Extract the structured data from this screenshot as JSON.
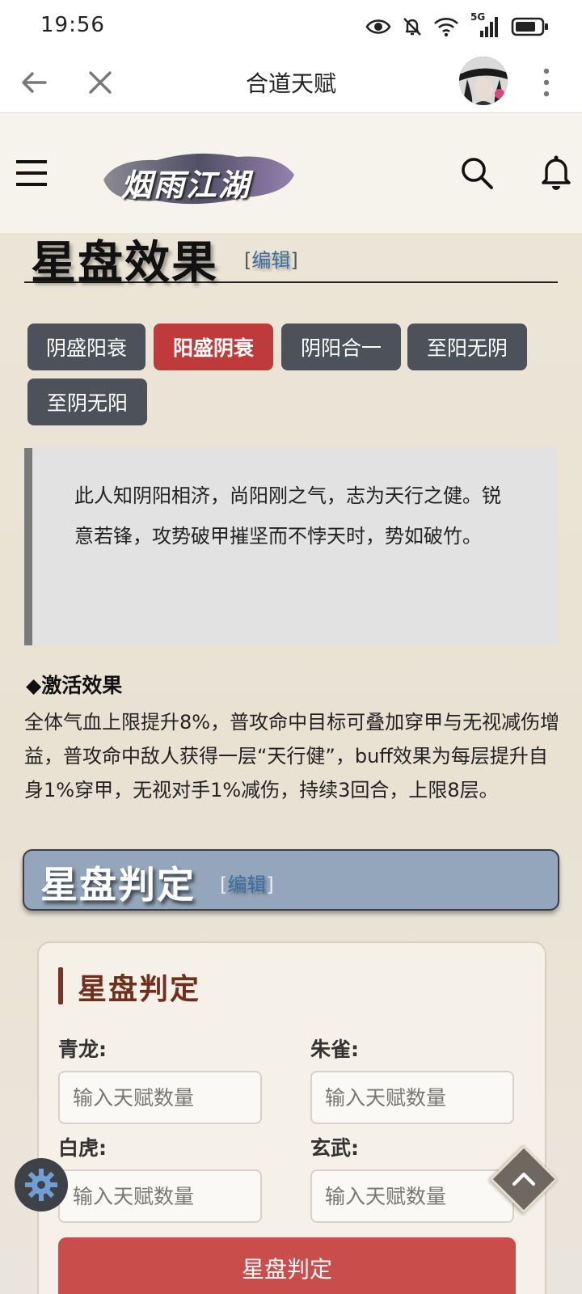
{
  "status_bar": {
    "time": "19:56",
    "network_label": "5G",
    "icons": [
      "eye-icon",
      "bell-off-icon",
      "wifi-icon",
      "signal-icon",
      "battery-icon"
    ]
  },
  "browser_bar": {
    "title": "合道天赋",
    "icons": [
      "back-arrow-icon",
      "close-icon",
      "avatar",
      "more-vertical-icon"
    ]
  },
  "site_header": {
    "logo_text": "烟雨江湖",
    "icons": [
      "menu-icon",
      "search-icon",
      "bell-icon"
    ]
  },
  "page": {
    "heading": "星盘效果",
    "edit_bracket_open": "[",
    "edit_label": "编辑",
    "edit_bracket_close": "]",
    "tabs": [
      {
        "label": "阴盛阳衰",
        "active": false
      },
      {
        "label": "阳盛阴衰",
        "active": true
      },
      {
        "label": "阴阳合一",
        "active": false
      },
      {
        "label": "至阳无阴",
        "active": false
      },
      {
        "label": "至阴无阳",
        "active": false
      }
    ],
    "quote": "此人知阴阳相济，尚阳刚之气，志为天行之健。锐意若锋，攻势破甲摧坚而不悖天时，势如破竹。",
    "activation_label": "◆激活效果",
    "activation_text": "全体气血上限提升8%，普攻命中目标可叠加穿甲与无视减伤增益，普攻命中敌人获得一层“天行健”，buff效果为每层提升自身1%穿甲，无视对手1%减伤，持续3回合，上限8层。",
    "section2_heading": "星盘判定",
    "card": {
      "title": "星盘判定",
      "fields": [
        {
          "label": "青龙:",
          "placeholder": "输入天赋数量"
        },
        {
          "label": "朱雀:",
          "placeholder": "输入天赋数量"
        },
        {
          "label": "白虎:",
          "placeholder": "输入天赋数量"
        },
        {
          "label": "玄武:",
          "placeholder": "输入天赋数量"
        }
      ],
      "submit_label": "星盘判定"
    }
  },
  "colors": {
    "active_tab": "#bf3b3b",
    "tab": "#4c515a",
    "section_bar": "#93a6bb",
    "card_title": "#6f2f1c",
    "submit": "#c94d4a"
  }
}
